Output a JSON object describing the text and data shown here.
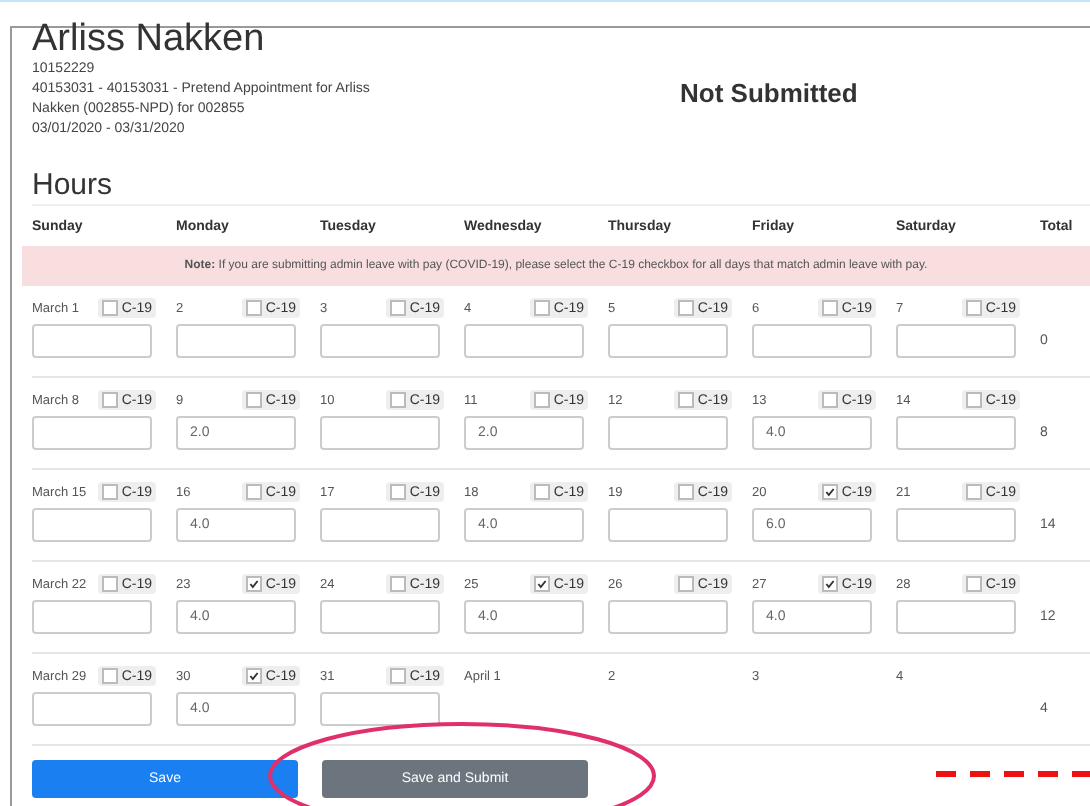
{
  "employee": {
    "name": "Arliss Nakken",
    "id": "10152229",
    "appointment": "40153031 - 40153031 - Pretend Appointment for Arliss Nakken (002855-NPD) for 002855",
    "period": "03/01/2020 - 03/31/2020"
  },
  "status": "Not Submitted",
  "section_title": "Hours",
  "columns": [
    "Sunday",
    "Monday",
    "Tuesday",
    "Wednesday",
    "Thursday",
    "Friday",
    "Saturday",
    "Total"
  ],
  "note": {
    "label": "Note:",
    "text": "If you are submitting admin leave with pay (COVID-19), please select the C-19 checkbox for all days that match admin leave with pay."
  },
  "weeks": [
    {
      "total": "0",
      "days": [
        {
          "kind": "entry",
          "label": "March 1",
          "checkbox": "C-19",
          "checked": false
        },
        {
          "kind": "entry",
          "label": "2",
          "checkbox": "C-19",
          "checked": false
        },
        {
          "kind": "entry",
          "label": "3",
          "checkbox": "C-19",
          "checked": false
        },
        {
          "kind": "entry",
          "label": "4",
          "checkbox": "C-19",
          "checked": false
        },
        {
          "kind": "entry",
          "label": "5",
          "checkbox": "C-19",
          "checked": false
        },
        {
          "kind": "entry",
          "label": "6",
          "checkbox": "C-19",
          "checked": false
        },
        {
          "kind": "entry",
          "label": "7",
          "checkbox": "C-19",
          "checked": false
        }
      ]
    },
    {
      "total": "8",
      "days": [
        {
          "kind": "entry",
          "label": "March 8",
          "checkbox": "C-19",
          "checked": false
        },
        {
          "kind": "entry",
          "label": "9",
          "checkbox": "C-19",
          "checked": false,
          "value": "2.0"
        },
        {
          "kind": "entry",
          "label": "10",
          "checkbox": "C-19",
          "checked": false
        },
        {
          "kind": "entry",
          "label": "11",
          "checkbox": "C-19",
          "checked": false,
          "value": "2.0"
        },
        {
          "kind": "entry",
          "label": "12",
          "checkbox": "C-19",
          "checked": false
        },
        {
          "kind": "entry",
          "label": "13",
          "checkbox": "C-19",
          "checked": false,
          "value": "4.0"
        },
        {
          "kind": "entry",
          "label": "14",
          "checkbox": "C-19",
          "checked": false
        }
      ]
    },
    {
      "total": "14",
      "days": [
        {
          "kind": "entry",
          "label": "March 15",
          "checkbox": "C-19",
          "checked": false
        },
        {
          "kind": "entry",
          "label": "16",
          "checkbox": "C-19",
          "checked": false,
          "value": "4.0"
        },
        {
          "kind": "entry",
          "label": "17",
          "checkbox": "C-19",
          "checked": false
        },
        {
          "kind": "entry",
          "label": "18",
          "checkbox": "C-19",
          "checked": false,
          "value": "4.0"
        },
        {
          "kind": "entry",
          "label": "19",
          "checkbox": "C-19",
          "checked": false
        },
        {
          "kind": "entry",
          "label": "20",
          "checkbox": "C-19",
          "checked": true,
          "value": "6.0"
        },
        {
          "kind": "entry",
          "label": "21",
          "checkbox": "C-19",
          "checked": false
        }
      ]
    },
    {
      "total": "12",
      "days": [
        {
          "kind": "entry",
          "label": "March 22",
          "checkbox": "C-19",
          "checked": false
        },
        {
          "kind": "entry",
          "label": "23",
          "checkbox": "C-19",
          "checked": true,
          "value": "4.0"
        },
        {
          "kind": "entry",
          "label": "24",
          "checkbox": "C-19",
          "checked": false
        },
        {
          "kind": "entry",
          "label": "25",
          "checkbox": "C-19",
          "checked": true,
          "value": "4.0"
        },
        {
          "kind": "entry",
          "label": "26",
          "checkbox": "C-19",
          "checked": false
        },
        {
          "kind": "entry",
          "label": "27",
          "checkbox": "C-19",
          "checked": true,
          "value": "4.0"
        },
        {
          "kind": "entry",
          "label": "28",
          "checkbox": "C-19",
          "checked": false
        }
      ]
    },
    {
      "total": "4",
      "days": [
        {
          "kind": "entry",
          "label": "March 29",
          "checkbox": "C-19",
          "checked": false
        },
        {
          "kind": "entry",
          "label": "30",
          "checkbox": "C-19",
          "checked": true,
          "value": "4.0"
        },
        {
          "kind": "entry",
          "label": "31",
          "checkbox": "C-19",
          "checked": false
        },
        {
          "kind": "outside",
          "label": "April 1"
        },
        {
          "kind": "outside",
          "label": "2"
        },
        {
          "kind": "outside",
          "label": "3"
        },
        {
          "kind": "outside",
          "label": "4"
        }
      ]
    }
  ],
  "buttons": [
    {
      "kind": "primary",
      "label": "Save"
    },
    {
      "kind": "secondary",
      "label": "Save and Submit"
    }
  ]
}
